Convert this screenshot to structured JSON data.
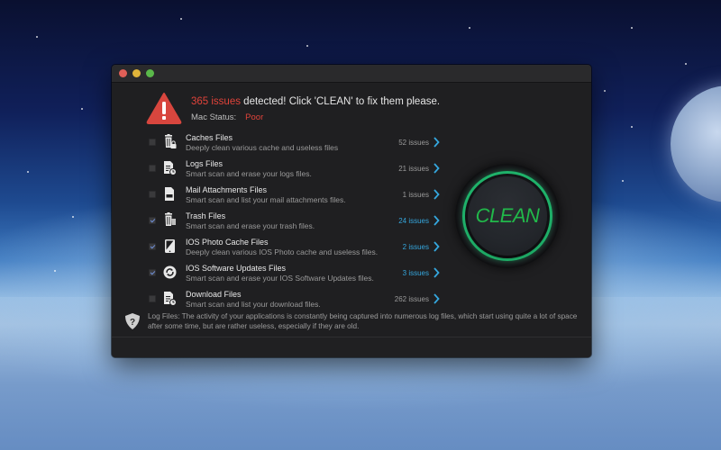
{
  "window": {
    "traffic_lights": [
      "close",
      "minimize",
      "maximize"
    ]
  },
  "header": {
    "issue_count": "365 issues",
    "headline_rest": " detected! Click 'CLEAN' to fix them please.",
    "status_label": "Mac Status:",
    "status_value": "Poor",
    "icon": "warning-triangle-icon"
  },
  "items": [
    {
      "title": "Caches Files",
      "desc": "Deeply clean various cache and useless files",
      "count": "52 issues",
      "checked": false,
      "icon": "trash-lock-icon"
    },
    {
      "title": "Logs Files",
      "desc": "Smart scan and erase your logs files.",
      "count": "21 issues",
      "checked": false,
      "icon": "document-clock-icon"
    },
    {
      "title": "Mail Attachments Files",
      "desc": "Smart scan and list your mail attachments files.",
      "count": "1 issues",
      "checked": false,
      "icon": "document-icon"
    },
    {
      "title": "Trash Files",
      "desc": "Smart scan and erase your trash files.",
      "count": "24 issues",
      "checked": true,
      "icon": "trash-icon"
    },
    {
      "title": "IOS Photo Cache Files",
      "desc": "Deeply clean various IOS Photo cache and useless files.",
      "count": "2 issues",
      "checked": true,
      "icon": "tablet-icon"
    },
    {
      "title": "IOS Software Updates Files",
      "desc": "Smart scan and erase your IOS Software Updates files.",
      "count": "3 issues",
      "checked": true,
      "icon": "refresh-icon"
    },
    {
      "title": "Download Files",
      "desc": "Smart scan and list your download files.",
      "count": "262 issues",
      "checked": false,
      "icon": "document-clock-icon"
    }
  ],
  "clean_button": {
    "label": "CLEAN"
  },
  "info": {
    "icon": "shield-question-icon",
    "text": "Log Files: The activity of your applications is constantly being captured into numerous log files, which start using quite a lot of space after some time, but are rather useless, especially if they are old."
  },
  "colors": {
    "alert_red": "#e0433a",
    "active_blue": "#35a7de",
    "clean_green": "#21b84a",
    "window_bg": "#1f1f21"
  }
}
